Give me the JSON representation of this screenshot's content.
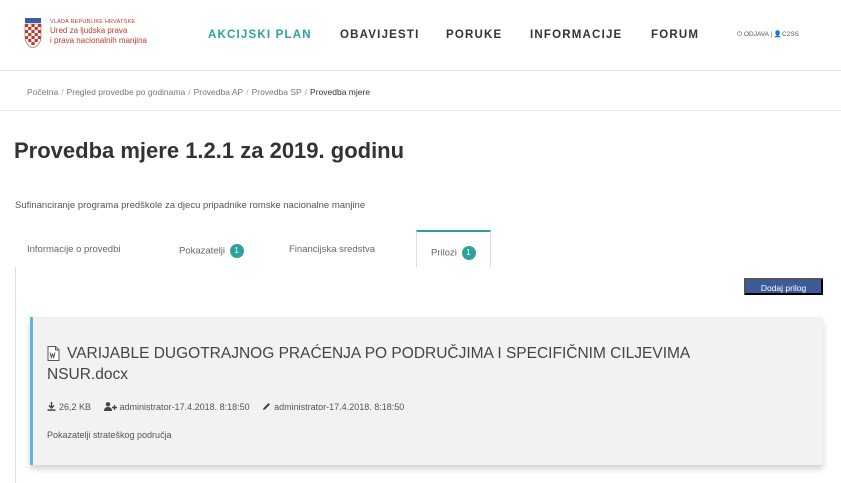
{
  "header": {
    "org_small": "VLADA REPUBLIKE HRVATSKE",
    "org_line1": "Ured za ljudska prava",
    "org_line2": "i prava nacionalnih manjina",
    "nav": [
      "AKCIJSKI PLAN",
      "OBAVIJESTI",
      "PORUKE",
      "INFORMACIJE",
      "FORUM"
    ],
    "active_nav": "AKCIJSKI PLAN",
    "right_links": "⏻ ODJAVA | 👤C2SS",
    "colors": {
      "accent": "#2ba39a",
      "brand_red": "#c0392b",
      "button": "#3d5a99",
      "card_border": "#5bb6e0"
    }
  },
  "breadcrumb": {
    "items": [
      "Početna",
      "Pregled provedbe po godinama",
      "Provedba AP",
      "Provedba SP"
    ],
    "current": "Provedba mjere"
  },
  "page": {
    "title_prefix": "Provedba mjere ",
    "title_number": "1.2.1",
    "title_suffix": " za 2019. godinu",
    "subtitle": "Sufinanciranje programa predškole za djecu pripadnike romske nacionalne manjine"
  },
  "tabs": [
    {
      "label": "Informacije o provedbi",
      "badge": ""
    },
    {
      "label": "Pokazatelji",
      "badge": "1"
    },
    {
      "label": "Financijska sredstva",
      "badge": ""
    },
    {
      "label": "Prilozi",
      "badge": "1"
    }
  ],
  "active_tab": "Prilozi",
  "attachments": {
    "add_button": "Dodaj prilog",
    "file": {
      "icon": "file-word-icon",
      "name": "VARIJABLE DUGOTRAJNOG PRAĆENJA PO PODRUČJIMA I SPECIFIČNIM CILJEVIMA NSUR.docx",
      "size": "26,2 KB",
      "created": "administrator-17.4.2018. 8:18:50",
      "modified": "administrator-17.4.2018. 8:18:50",
      "description": "Pokazatelji strateškog područja"
    }
  }
}
